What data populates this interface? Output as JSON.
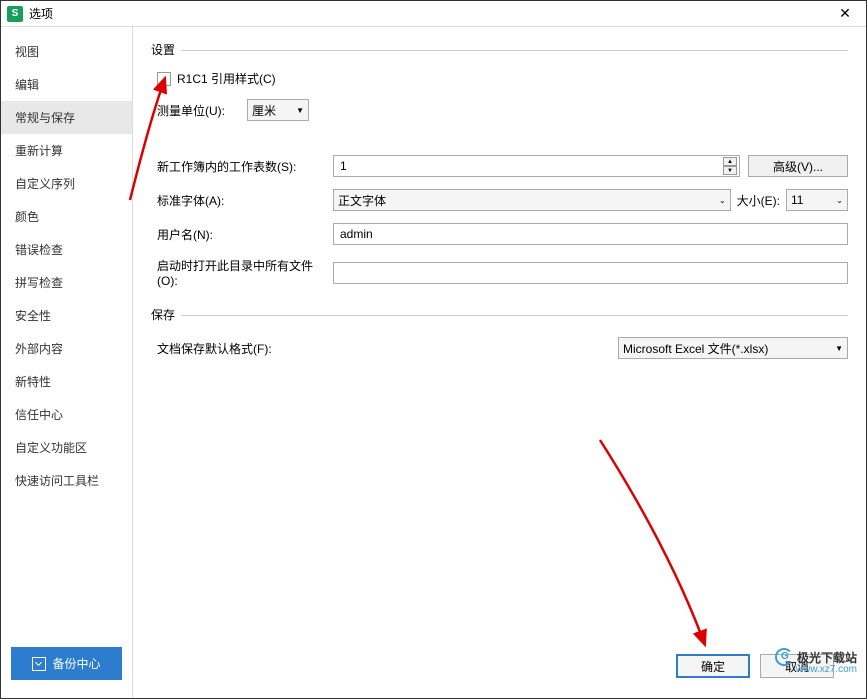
{
  "titlebar": {
    "icon_letter": "S",
    "title": "选项"
  },
  "sidebar": {
    "items": [
      {
        "label": "视图"
      },
      {
        "label": "编辑"
      },
      {
        "label": "常规与保存"
      },
      {
        "label": "重新计算"
      },
      {
        "label": "自定义序列"
      },
      {
        "label": "颜色"
      },
      {
        "label": "错误检查"
      },
      {
        "label": "拼写检查"
      },
      {
        "label": "安全性"
      },
      {
        "label": "外部内容"
      },
      {
        "label": "新特性"
      },
      {
        "label": "信任中心"
      },
      {
        "label": "自定义功能区"
      },
      {
        "label": "快速访问工具栏"
      }
    ],
    "backup_label": "备份中心"
  },
  "main": {
    "section_settings": "设置",
    "r1c1_label": "R1C1 引用样式(C)",
    "unit_label": "测量单位(U):",
    "unit_value": "厘米",
    "sheets_label": "新工作簿内的工作表数(S):",
    "sheets_value": "1",
    "advanced_btn": "高级(V)...",
    "font_label": "标准字体(A):",
    "font_value": "正文字体",
    "size_label": "大小(E):",
    "size_value": "11",
    "username_label": "用户名(N):",
    "username_value": "admin",
    "startup_label": "启动时打开此目录中所有文件(O):",
    "startup_value": "",
    "section_save": "保存",
    "format_label": "文档保存默认格式(F):",
    "format_value": "Microsoft Excel 文件(*.xlsx)"
  },
  "footer": {
    "ok": "确定",
    "cancel": "取消"
  },
  "watermark": {
    "line1": "极光下载站",
    "line2": "www.xz7.com"
  }
}
